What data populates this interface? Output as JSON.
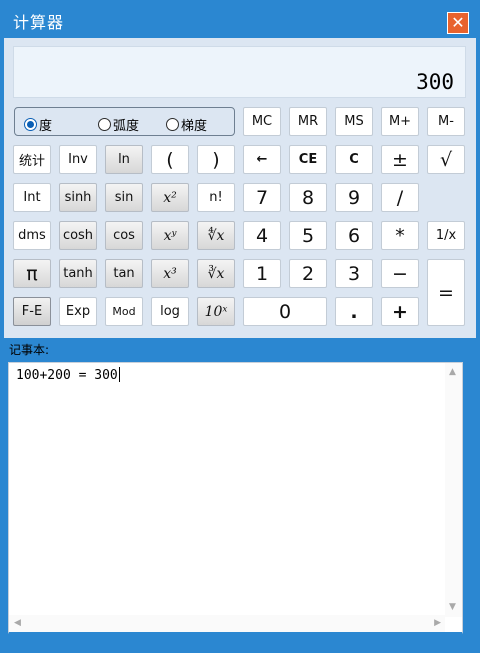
{
  "window": {
    "title": "计算器",
    "close_symbol": "✕"
  },
  "display": {
    "value": "300"
  },
  "angle_units": {
    "options": [
      "度",
      "弧度",
      "梯度"
    ],
    "selected": "度"
  },
  "memory": {
    "mc": "MC",
    "mr": "MR",
    "ms": "MS",
    "m_plus": "M+",
    "m_minus": "M-"
  },
  "keys": {
    "stats": "统计",
    "inv": "Inv",
    "ln": "ln",
    "lparen": "(",
    "rparen": ")",
    "backspace": "←",
    "ce": "CE",
    "c": "C",
    "plusminus": "±",
    "sqrt": "√",
    "int": "Int",
    "sinh": "sinh",
    "sin": "sin",
    "x2": "x²",
    "fact": "n!",
    "n7": "7",
    "n8": "8",
    "n9": "9",
    "divide": "/",
    "dms": "dms",
    "cosh": "cosh",
    "cos": "cos",
    "xy": "xʸ",
    "yroot": "∜x",
    "n4": "4",
    "n5": "5",
    "n6": "6",
    "multiply": "*",
    "reciprocal": "1/x",
    "pi": "π",
    "tanh": "tanh",
    "tan": "tan",
    "x3": "x³",
    "cbrt": "∛x",
    "n1": "1",
    "n2": "2",
    "n3": "3",
    "minus": "−",
    "equals": "=",
    "fe": "F-E",
    "exp": "Exp",
    "mod": "Mod",
    "log": "log",
    "pow10": "10ˣ",
    "n0": "0",
    "decimal": ".",
    "plus": "+"
  },
  "notepad": {
    "label": "记事本:",
    "content": "100+200 = 300"
  },
  "colors": {
    "accent": "#2b87d1",
    "close": "#e8632e",
    "panel": "#dce6f2",
    "display_bg": "#edf4fb"
  }
}
